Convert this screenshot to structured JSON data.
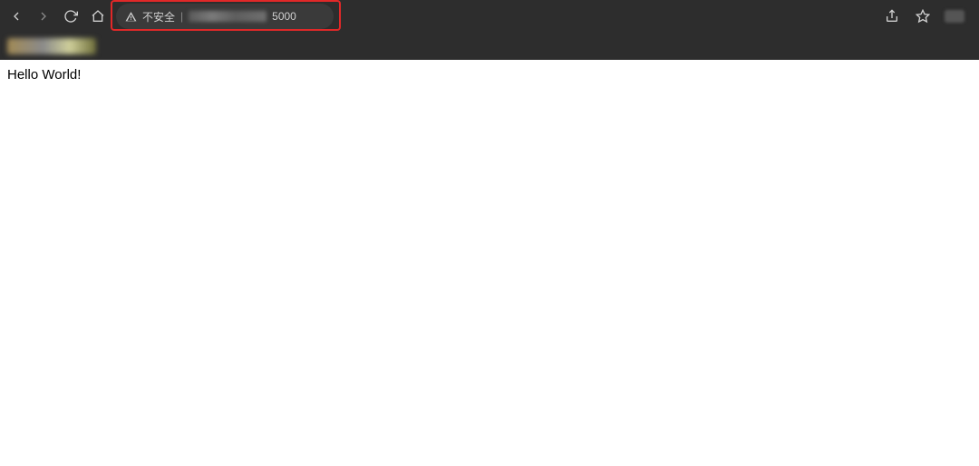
{
  "toolbar": {
    "security_text": "不安全",
    "separator": "|",
    "port": "5000"
  },
  "page": {
    "body_text": "Hello World!"
  }
}
